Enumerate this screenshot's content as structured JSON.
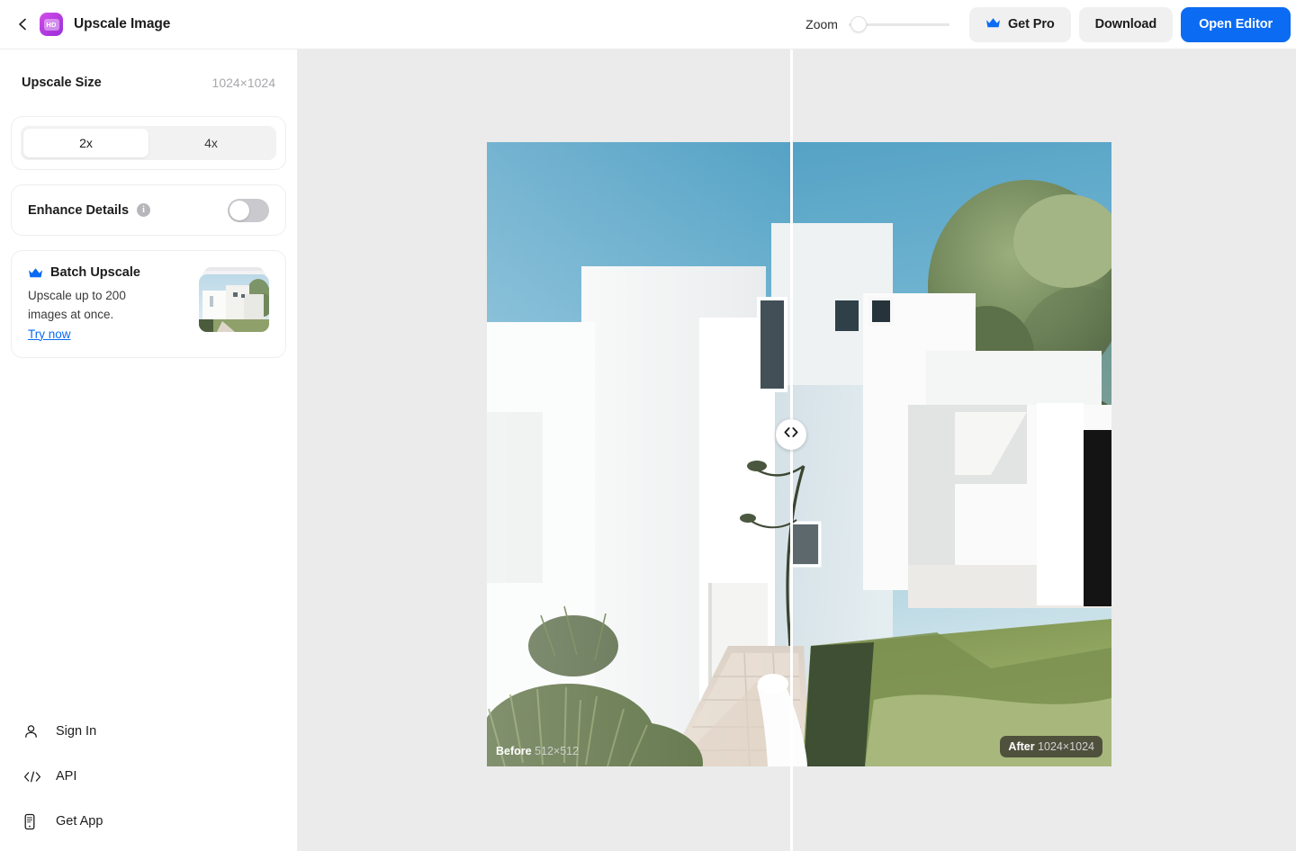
{
  "header": {
    "back_icon": "chevron-left-icon",
    "app_icon": "hd-upscale-app-icon",
    "app_icon_text": "HD",
    "title": "Upscale Image",
    "zoom_label": "Zoom",
    "zoom_value": 0,
    "get_pro_label": "Get Pro",
    "get_pro_icon": "crown-icon",
    "download_label": "Download",
    "open_editor_label": "Open Editor",
    "accent_blue": "#0b6bf2"
  },
  "sidebar": {
    "upscale_size": {
      "label": "Upscale Size",
      "value": "1024×1024"
    },
    "scale_options": [
      {
        "label": "2x",
        "selected": true
      },
      {
        "label": "4x",
        "selected": false
      }
    ],
    "enhance_details": {
      "label": "Enhance Details",
      "info_icon": "info-icon",
      "enabled": false
    },
    "batch_upscale": {
      "icon": "crown-icon",
      "title": "Batch Upscale",
      "description": "Upscale up to 200 images at once.",
      "link_label": "Try now"
    },
    "nav_items": [
      {
        "icon": "user-icon",
        "label": "Sign In"
      },
      {
        "icon": "code-icon",
        "label": "API"
      },
      {
        "icon": "phone-icon",
        "label": "Get App"
      }
    ]
  },
  "canvas": {
    "background": "#ebebeb",
    "before_label": "Before",
    "before_size": "512×512",
    "after_label": "After",
    "after_size": "1024×1024",
    "handle_icon": "left-right-chevron-icon",
    "divider_position_percent": 50
  }
}
